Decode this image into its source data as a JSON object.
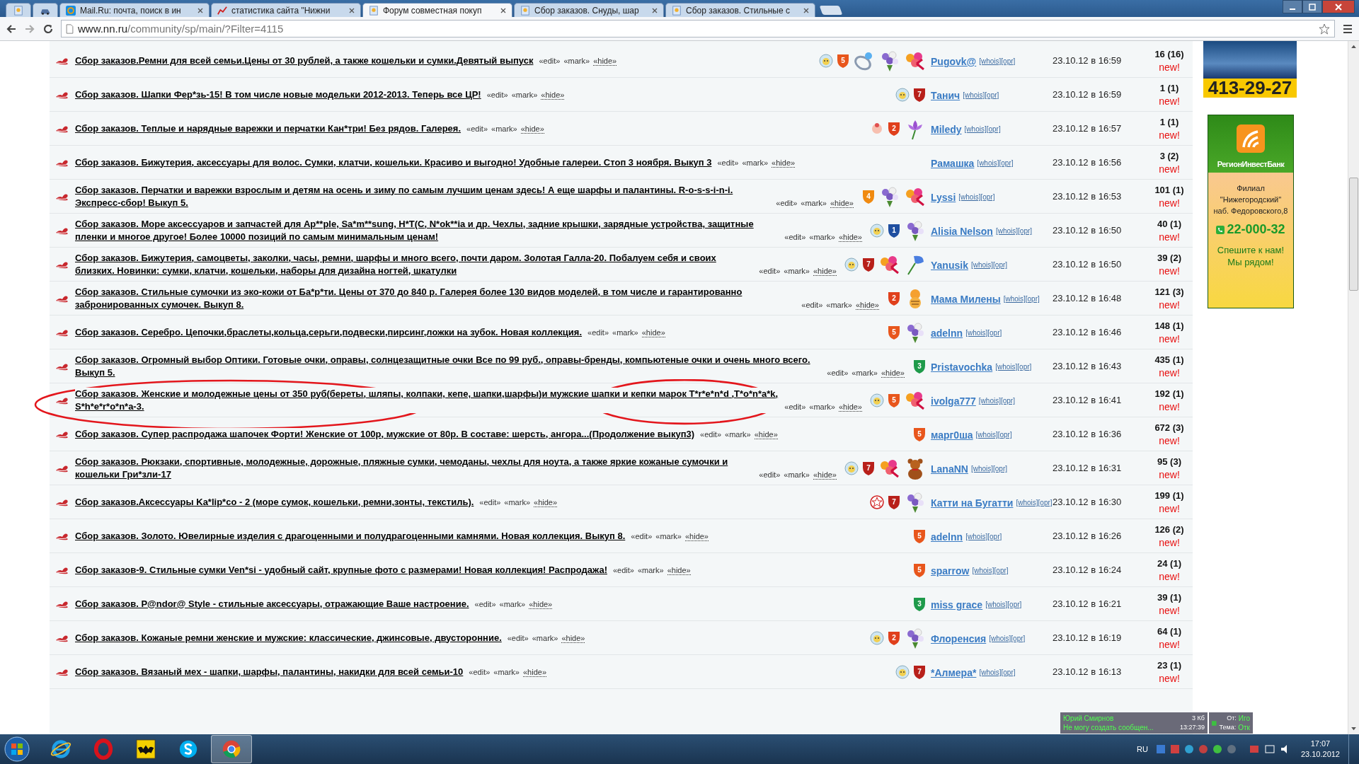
{
  "browser": {
    "tabs": [
      {
        "selected": false
      },
      {
        "selected": false
      },
      {
        "label": "Mail.Ru: почта, поиск в ин",
        "selected": false
      },
      {
        "label": "статистика сайта \"Нижни",
        "selected": false
      },
      {
        "label": "Форум совместная покуп",
        "selected": true
      },
      {
        "label": "Сбор заказов. Снуды, шар",
        "selected": false
      },
      {
        "label": "Сбор заказов. Стильные с",
        "selected": false
      }
    ],
    "address": {
      "host": "www.nn.ru",
      "path": "/community/sp/main/?Filter=4115"
    }
  },
  "topics": [
    {
      "title": "Сбор заказов.Ремни для всей семьи.Цены от 30 рублей, а также кошельки и сумки.Девятый выпуск",
      "actions": [
        "«edit»",
        "«mark»",
        "«hide»"
      ],
      "badges": [
        {
          "kind": "smiley"
        },
        {
          "kind": "shield",
          "text": "5",
          "color": "#e8561c"
        },
        {
          "kind": "ring"
        },
        {
          "kind": "bouquet"
        },
        {
          "kind": "flowers"
        }
      ],
      "author": "Pugovk@",
      "links": [
        "[whois]",
        "[opr]"
      ],
      "date": "23.10.12 в 16:59",
      "count": "16 (16)",
      "new": "new!"
    },
    {
      "title": "Сбор заказов. Шапки Фер*зь-15! В том числе новые модельки 2012-2013. Теперь все ЦР!",
      "actions": [
        "«edit»",
        "«mark»",
        "«hide»"
      ],
      "badges": [
        {
          "kind": "smiley"
        },
        {
          "kind": "shield",
          "text": "7",
          "color": "#b8201a"
        }
      ],
      "author": "Танич",
      "links": [
        "[whois]",
        "[opr]"
      ],
      "date": "23.10.12 в 16:59",
      "count": "1 (1)",
      "new": "new!"
    },
    {
      "title": "Сбор заказов. Теплые и нарядные варежки и перчатки Кан*три! Без рядов. Галерея.",
      "actions": [
        "«edit»",
        "«mark»",
        "«hide»"
      ],
      "badges": [
        {
          "kind": "baby"
        },
        {
          "kind": "shield",
          "text": "2",
          "color": "#e0401c"
        },
        {
          "kind": "flower"
        }
      ],
      "author": "Miledy",
      "links": [
        "[whois]",
        "[opr]"
      ],
      "date": "23.10.12 в 16:57",
      "count": "1 (1)",
      "new": "new!"
    },
    {
      "title": "Сбор заказов. Бижутерия, аксессуары для волос. Сумки, клатчи, кошельки. Красиво и выгодно! Удобные галереи. Стоп 3 ноября. Выкуп 3",
      "actions": [
        "«edit»",
        "«mark»",
        "«hide»"
      ],
      "author": "Рамашка",
      "links": [
        "[whois]",
        "[opr]"
      ],
      "date": "23.10.12 в 16:56",
      "count": "3 (2)",
      "new": "new!"
    },
    {
      "title": "Сбор заказов. Перчатки и варежки взрослым и детям на осень и зиму по самым лучшим ценам здесь! А еще шарфы и палантины. R-o-s-s-i-n-i. Экспресс-сбор! Выкуп 5.",
      "actions": [
        "«edit»",
        "«mark»",
        "«hide»"
      ],
      "badges": [
        {
          "kind": "shield",
          "text": "4",
          "color": "#f08a10"
        },
        {
          "kind": "bouquet"
        },
        {
          "kind": "flowers"
        }
      ],
      "author": "Lyssi",
      "links": [
        "[whois]",
        "[opr]"
      ],
      "date": "23.10.12 в 16:53",
      "count": "101 (1)",
      "new": "new!"
    },
    {
      "title": "Сбор заказов. Море аксессуаров и запчастей для Ap**ple, Sa*m**sung, H*T(C, N*ok**ia и др. Чехлы, задние крышки, зарядные устройства, защитные пленки и многое другое! Более 10000 позиций по самым минимальным ценам!",
      "actions": [
        "«edit»",
        "«mark»",
        "«hide»"
      ],
      "badges": [
        {
          "kind": "smiley"
        },
        {
          "kind": "shield",
          "text": "1",
          "color": "#1f4fa0"
        },
        {
          "kind": "bouquet"
        }
      ],
      "author": "Alisia Nelson",
      "links": [
        "[whois]",
        "[opr]"
      ],
      "date": "23.10.12 в 16:50",
      "count": "40 (1)",
      "new": "new!"
    },
    {
      "title": "Сбор заказов. Бижутерия, самоцветы, заколки, часы, ремни, шарфы и много всего, почти даром. Золотая Галла-20. Побалуем себя и своих близких. Новинки: сумки, клатчи, кошельки, наборы для дизайна ногтей, шкатулки",
      "actions": [
        "«edit»",
        "«mark»",
        "«hide»"
      ],
      "badges": [
        {
          "kind": "smiley"
        },
        {
          "kind": "shield",
          "text": "7",
          "color": "#b8201a"
        },
        {
          "kind": "flowers"
        },
        {
          "kind": "bell"
        }
      ],
      "author": "Yanusik",
      "links": [
        "[whois]",
        "[opr]"
      ],
      "date": "23.10.12 в 16:50",
      "count": "39 (2)",
      "new": "new!"
    },
    {
      "title": "Сбор заказов. Стильные сумочки из эко-кожи от Ба*р*ти. Цены от 370 до 840 р. Галерея более 130 видов моделей, в том числе и гарантированно забронированных сумочек. Выкуп 8.",
      "actions": [
        "«edit»",
        "«mark»",
        "«hide»"
      ],
      "badges": [
        {
          "kind": "shield",
          "text": "2",
          "color": "#e0401c"
        },
        {
          "kind": "tiger"
        }
      ],
      "author": "Мама Милены",
      "links": [
        "[whois]",
        "[opr]"
      ],
      "date": "23.10.12 в 16:48",
      "count": "121 (3)",
      "new": "new!"
    },
    {
      "title": "Сбор заказов. Серебро. Цепочки,браслеты,кольца,серьги,подвески,пирсинг,ложки на зубок. Новая коллекция.",
      "actions": [
        "«edit»",
        "«mark»",
        "«hide»"
      ],
      "badges": [
        {
          "kind": "shield",
          "text": "5",
          "color": "#e8561c"
        },
        {
          "kind": "bouquet"
        }
      ],
      "author": "adelnn",
      "links": [
        "[whois]",
        "[opr]"
      ],
      "date": "23.10.12 в 16:46",
      "count": "148 (1)",
      "new": "new!"
    },
    {
      "title": "Сбор заказов. Огромный выбор Оптики. Готовые очки, оправы, солнцезащитные очки Все по 99 руб., оправы-бренды, компьютеные очки и очень много всего. Выкуп 5.",
      "actions": [
        "«edit»",
        "«mark»",
        "«hide»"
      ],
      "badges": [
        {
          "kind": "shield",
          "text": "3",
          "color": "#1e9a4a"
        }
      ],
      "author": "Pristavochka",
      "links": [
        "[whois]",
        "[opr]"
      ],
      "date": "23.10.12 в 16:43",
      "count": "435 (1)",
      "new": "new!"
    },
    {
      "title": "Сбор заказов. Женские и молодежные цены от 350 руб(береты, шляпы, колпаки, кепе, шапки,шарфы)и мужские шапки и кепки марок T*r*e*n*d ,T*o*n*a*k, S*h*e*r*o*n*a-3.",
      "actions": [
        "«edit»",
        "«mark»",
        "«hide»"
      ],
      "badges": [
        {
          "kind": "smiley"
        },
        {
          "kind": "shield",
          "text": "5",
          "color": "#e8561c"
        },
        {
          "kind": "flowers"
        }
      ],
      "author": "ivolga777",
      "links": [
        "[whois]",
        "[opr]"
      ],
      "date": "23.10.12 в 16:41",
      "count": "192 (1)",
      "new": "new!",
      "circled": true
    },
    {
      "title": "Сбор заказов. Супер распродажа шапочек Форти! Женские от 100р, мужские от 80р. В составе: шерсть, ангора...(Продолжение выкуп3)",
      "actions": [
        "«edit»",
        "«mark»",
        "«hide»"
      ],
      "badges": [
        {
          "kind": "shield",
          "text": "5",
          "color": "#e8561c"
        }
      ],
      "author": "марг0ша",
      "links": [
        "[whois]",
        "[opr]"
      ],
      "date": "23.10.12 в 16:36",
      "count": "672 (3)",
      "new": "new!"
    },
    {
      "title": "Сбор заказов. Рюкзаки, спортивные, молодежные, дорожные, пляжные сумки, чемоданы, чехлы для ноута, а также яркие кожаные сумочки и кошельки Гри*зли-17",
      "actions": [
        "«edit»",
        "«mark»",
        "«hide»"
      ],
      "badges": [
        {
          "kind": "smiley"
        },
        {
          "kind": "shield",
          "text": "7",
          "color": "#b8201a"
        },
        {
          "kind": "flowers"
        },
        {
          "kind": "bear"
        }
      ],
      "author": "LanaNN",
      "links": [
        "[whois]",
        "[opr]"
      ],
      "date": "23.10.12 в 16:31",
      "count": "95 (3)",
      "new": "new!"
    },
    {
      "title": "Сбор заказов.Аксессуары Ka*lip*co - 2 (море сумок, кошельки, ремни,зонты, текстиль).",
      "actions": [
        "«edit»",
        "«mark»",
        "«hide»"
      ],
      "badges": [
        {
          "kind": "star"
        },
        {
          "kind": "shield",
          "text": "7",
          "color": "#b8201a"
        },
        {
          "kind": "bouquet"
        }
      ],
      "author": "Катти на Бугатти",
      "links": [
        "[whois]",
        "[opr]"
      ],
      "date": "23.10.12 в 16:30",
      "count": "199 (1)",
      "new": "new!"
    },
    {
      "title": "Сбор заказов. Золото. Ювелирные изделия с драгоценными и полудрагоценными камнями. Новая коллекция. Выкуп 8.",
      "actions": [
        "«edit»",
        "«mark»",
        "«hide»"
      ],
      "badges": [
        {
          "kind": "shield",
          "text": "5",
          "color": "#e8561c"
        }
      ],
      "author": "adelnn",
      "links": [
        "[whois]",
        "[opr]"
      ],
      "date": "23.10.12 в 16:26",
      "count": "126 (2)",
      "new": "new!"
    },
    {
      "title": "Сбор заказов-9. Стильные сумки Ven*si - удобный сайт, крупные фото с размерами! Новая коллекция! Распродажа!",
      "actions": [
        "«edit»",
        "«mark»",
        "«hide»"
      ],
      "badges": [
        {
          "kind": "shield",
          "text": "5",
          "color": "#e8561c"
        }
      ],
      "author": "sparrow",
      "links": [
        "[whois]",
        "[opr]"
      ],
      "date": "23.10.12 в 16:24",
      "count": "24 (1)",
      "new": "new!"
    },
    {
      "title": "Сбор заказов. P@ndor@ Style - стильные аксессуары, отражающие Ваше настроение.",
      "actions": [
        "«edit»",
        "«mark»",
        "«hide»"
      ],
      "badges": [
        {
          "kind": "shield",
          "text": "3",
          "color": "#1e9a4a"
        }
      ],
      "author": "miss grace",
      "links": [
        "[whois]",
        "[opr]"
      ],
      "date": "23.10.12 в 16:21",
      "count": "39 (1)",
      "new": "new!"
    },
    {
      "title": "Сбор заказов. Кожаные ремни женские и мужские: классические, джинсовые, двусторонние.",
      "actions": [
        "«edit»",
        "«mark»",
        "«hide»"
      ],
      "badges": [
        {
          "kind": "smiley"
        },
        {
          "kind": "shield",
          "text": "2",
          "color": "#e0401c"
        },
        {
          "kind": "bouquet"
        }
      ],
      "author": "Флоренсия",
      "links": [
        "[whois]",
        "[opr]"
      ],
      "date": "23.10.12 в 16:19",
      "count": "64 (1)",
      "new": "new!"
    },
    {
      "title": "Сбор заказов. Вязаный мех - шапки, шарфы, палантины, накидки для всей семьи-10",
      "actions": [
        "«edit»",
        "«mark»",
        "«hide»"
      ],
      "badges": [
        {
          "kind": "smiley"
        },
        {
          "kind": "shield",
          "text": "7",
          "color": "#b8201a"
        }
      ],
      "author": "*Алмера*",
      "links": [
        "[whois]",
        "[opr]"
      ],
      "date": "23.10.12 в 16:13",
      "count": "23 (1)",
      "new": "new!"
    }
  ],
  "ads": {
    "phone_top": "413-29-27",
    "bank": {
      "name": "РегионИнвестБанк",
      "lines": [
        "Филиал",
        "\"Нижегородский\"",
        "наб. Федоровского,8"
      ],
      "phone": "22-000-32",
      "slogan": [
        "Спешите к нам!",
        "Мы рядом!"
      ]
    }
  },
  "notifications": [
    {
      "kind": "message",
      "sender": "Юрий Смирнов",
      "text": "Не могу создать сообщен...",
      "size": "3 Кб",
      "time": "13:27:39"
    },
    {
      "kind": "mail",
      "from_label": "От:",
      "from": "Иго",
      "subject_label": "Тема:",
      "subject": "Отк"
    }
  ],
  "taskbar": {
    "apps": [
      {
        "selected": false
      },
      {
        "selected": false
      },
      {
        "selected": false
      },
      {
        "selected": false
      },
      {
        "selected": true
      }
    ],
    "language": "RU",
    "time": "17:07",
    "date": "23.10.2012"
  }
}
